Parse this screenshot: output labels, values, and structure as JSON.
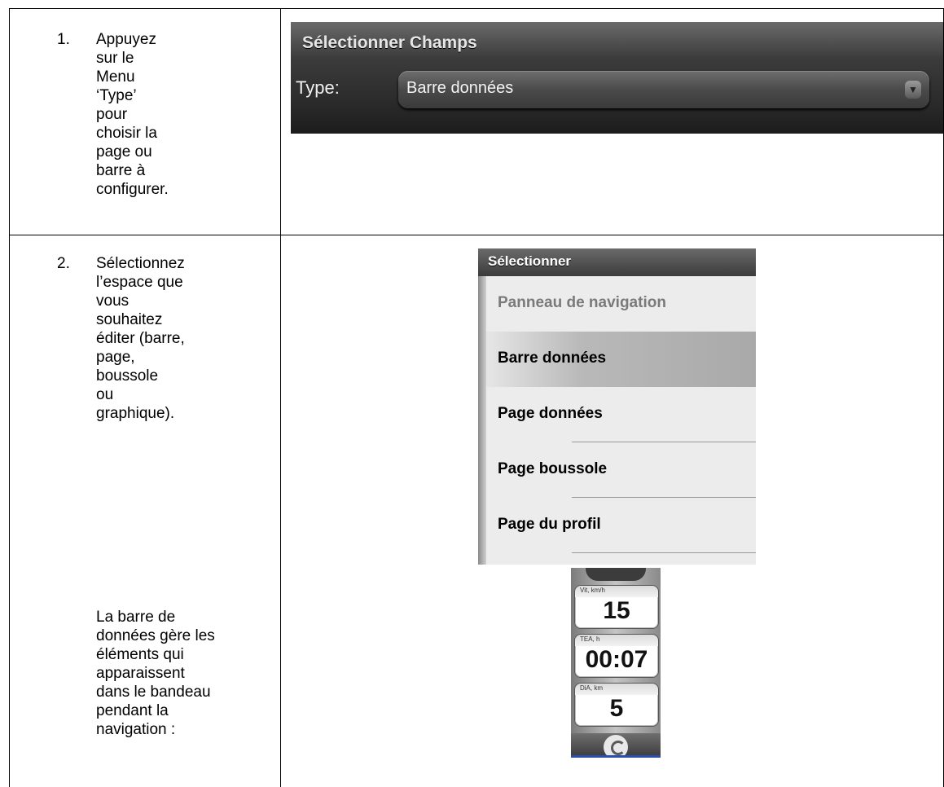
{
  "steps": [
    {
      "number": "1.",
      "text": "Appuyez sur le\nMenu ‘Type’ pour\nchoisir la page ou\nbarre à\nconfigurer."
    },
    {
      "number": "2.",
      "text": "Sélectionnez\nl’espace que\nvous souhaitez\néditer (barre,\npage, boussole\nou graphique)."
    }
  ],
  "note": "La barre de\ndonnées gère les\néléments qui\napparaissent\ndans le bandeau\npendant la\nnavigation :",
  "screen1": {
    "title": "Sélectionner Champs",
    "type_label": "Type:",
    "type_value": "Barre données"
  },
  "screen2": {
    "title": "Sélectionner",
    "items": [
      {
        "label": "Panneau de navigation",
        "state": "disabled"
      },
      {
        "label": "Barre données",
        "state": "selected"
      },
      {
        "label": "Page données",
        "state": "normal"
      },
      {
        "label": "Page boussole",
        "state": "normal"
      },
      {
        "label": "Page du profil",
        "state": "normal"
      }
    ]
  },
  "screen3": {
    "fields": [
      {
        "label": "Vit, km/h",
        "value": "15"
      },
      {
        "label": "TEA, h",
        "value": "00:07"
      },
      {
        "label": "DiA, km",
        "value": "5"
      }
    ]
  }
}
